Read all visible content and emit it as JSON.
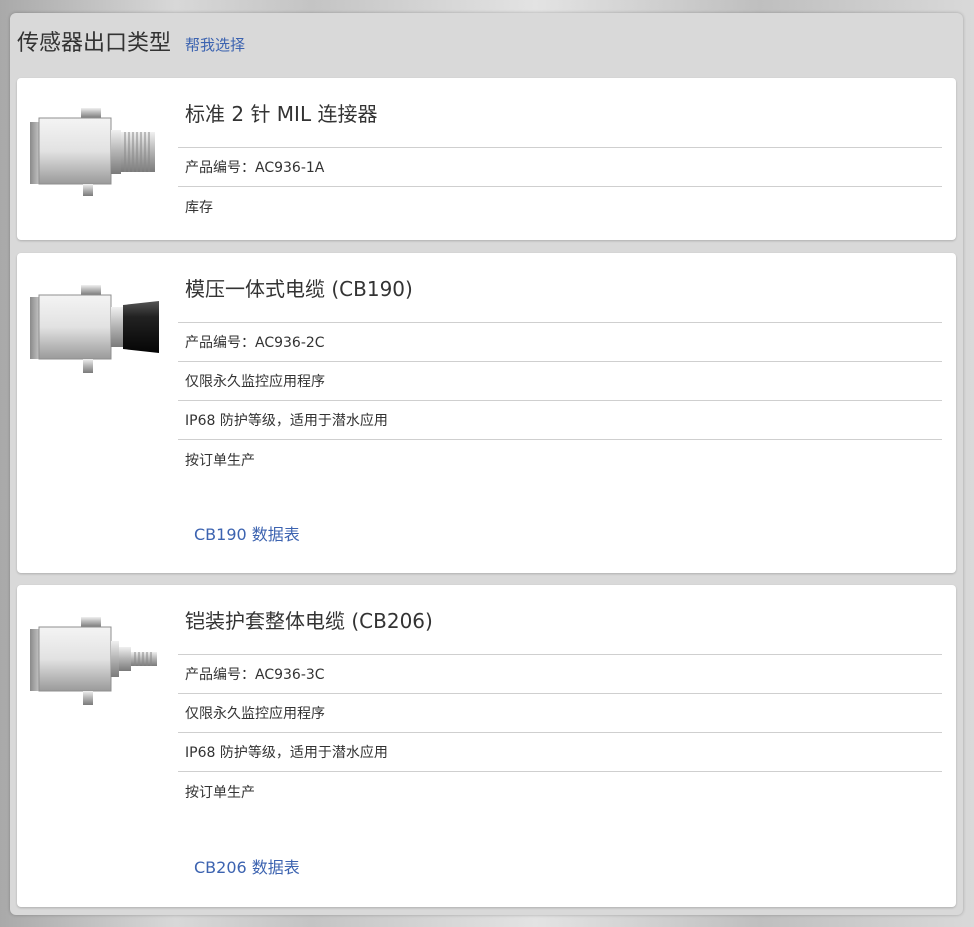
{
  "header": {
    "title": "传感器出口类型",
    "help_link": "帮我选择"
  },
  "products": [
    {
      "title": "标准 2 针 MIL 连接器",
      "part_number": "产品编号：AC936-1A",
      "specs": [
        "库存"
      ],
      "datasheet": "",
      "image_icon": "mil-connector-sensor-icon"
    },
    {
      "title": "模压一体式电缆 (CB190)",
      "part_number": "产品编号：AC936-2C",
      "specs": [
        "仅限永久监控应用程序",
        "IP68 防护等级，适用于潜水应用",
        "按订单生产"
      ],
      "datasheet": "CB190 数据表",
      "image_icon": "molded-cable-sensor-icon"
    },
    {
      "title": "铠装护套整体电缆 (CB206)",
      "part_number": "产品编号：AC936-3C",
      "specs": [
        "仅限永久监控应用程序",
        "IP68 防护等级，适用于潜水应用",
        "按订单生产"
      ],
      "datasheet": "CB206 数据表",
      "image_icon": "armored-cable-sensor-icon"
    }
  ],
  "colors": {
    "link": "#3c63b0",
    "text": "#333333",
    "panel": "#d9d9d9",
    "card": "#ffffff"
  }
}
